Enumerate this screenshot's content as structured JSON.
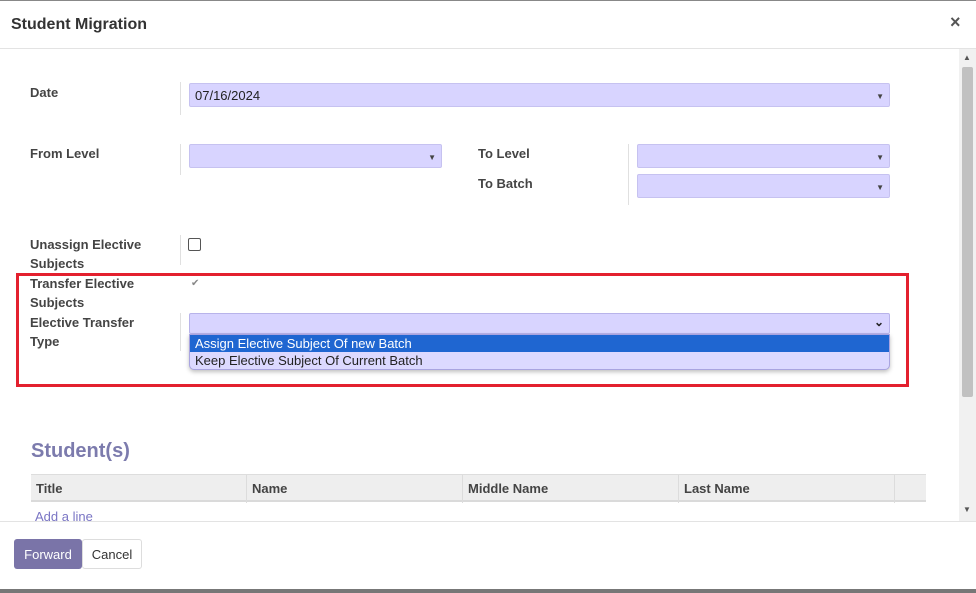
{
  "dialog": {
    "title": "Student Migration",
    "close_icon": "×"
  },
  "form": {
    "date_label": "Date",
    "date_value": "07/16/2024",
    "from_level_label": "From Level",
    "from_level_value": "",
    "to_level_label": "To Level",
    "to_level_value": "",
    "to_batch_label": "To Batch",
    "to_batch_value": "",
    "unassign_label_line1": "Unassign Elective",
    "unassign_label_line2": "Subjects",
    "unassign_checked": false,
    "transfer_label_line1": "Transfer Elective",
    "transfer_label_line2": "Subjects",
    "transfer_checked": true,
    "elective_type_label_line1": "Elective Transfer",
    "elective_type_label_line2": "Type",
    "elective_type_value": "",
    "elective_type_options": [
      "Assign Elective Subject Of new Batch",
      "Keep Elective Subject Of Current Batch"
    ]
  },
  "students": {
    "section_title": "Student(s)",
    "columns": [
      "Title",
      "Name",
      "Middle Name",
      "Last Name"
    ],
    "add_line": "Add a line"
  },
  "footer": {
    "forward_label": "Forward",
    "cancel_label": "Cancel"
  },
  "colors": {
    "field_bg": "#d8d4ff",
    "primary_button": "#7a74a8",
    "highlight_border": "#e3202e",
    "selected_option": "#1f66d1",
    "section_title": "#7c7bad"
  },
  "icons": {
    "close": "close-icon",
    "dropdown_caret": "caret-down-icon",
    "select_chevron": "chevron-down-icon",
    "checkmark": "checkmark-icon"
  }
}
